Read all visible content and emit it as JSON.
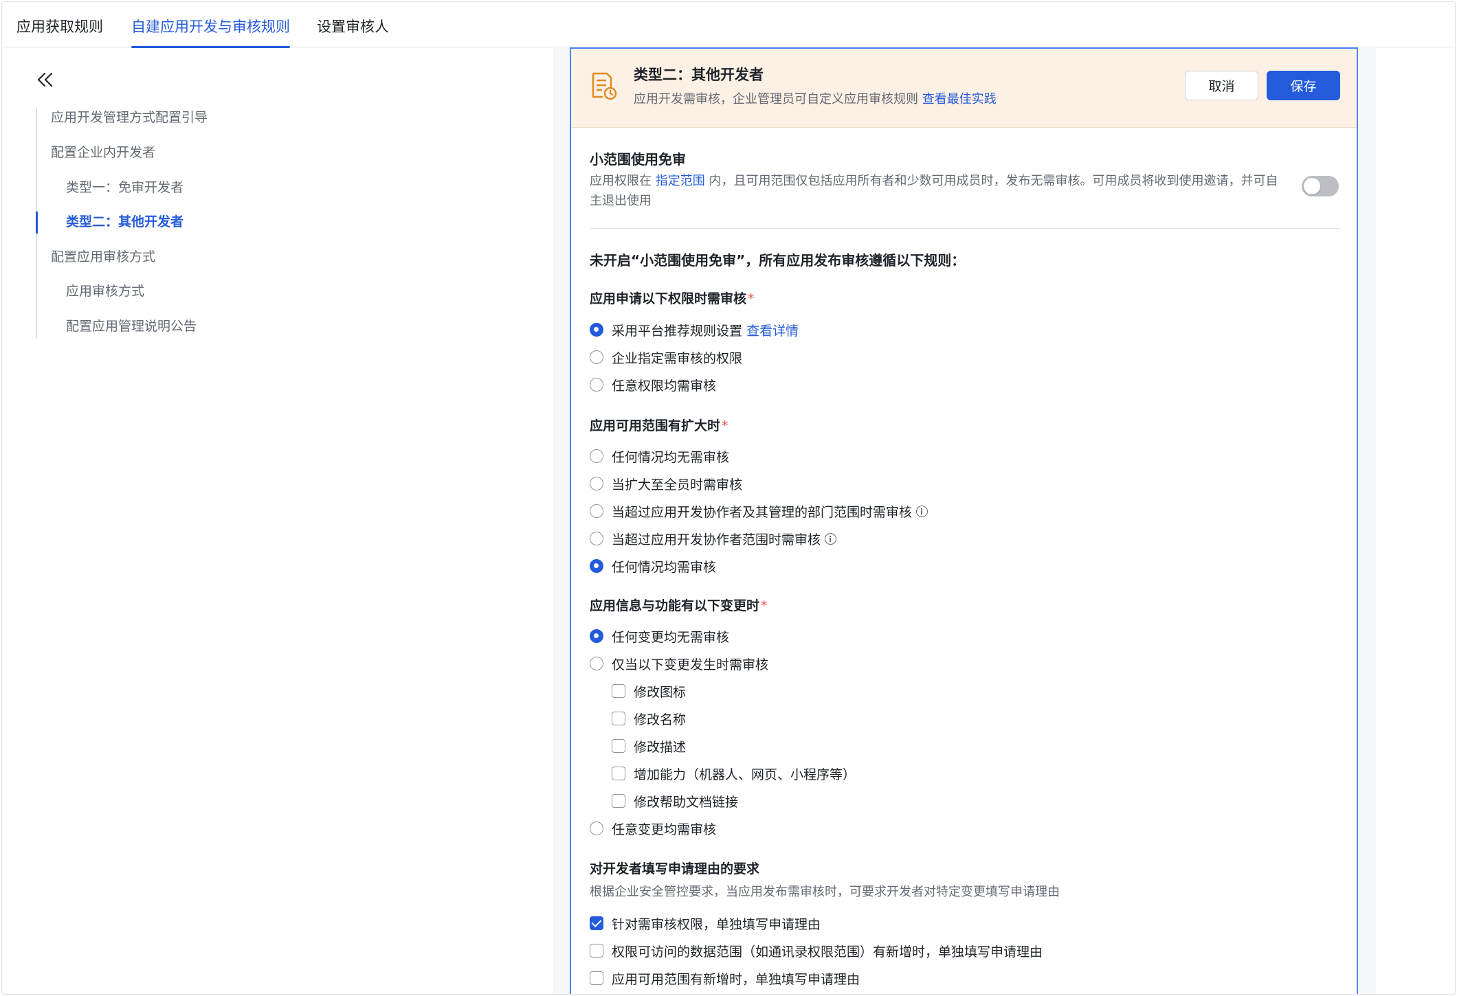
{
  "tabs": [
    {
      "label": "应用获取规则"
    },
    {
      "label": "自建应用开发与审核规则",
      "active": true
    },
    {
      "label": "设置审核人"
    }
  ],
  "sidebar": {
    "collapse_icon": "double-chevron-left-icon",
    "items": [
      {
        "label": "应用开发管理方式配置引导"
      },
      {
        "label": "配置企业内开发者"
      },
      {
        "label": "类型一：免审开发者"
      },
      {
        "label": "类型二：其他开发者",
        "active": true
      },
      {
        "label": "配置应用审核方式"
      },
      {
        "label": "应用审核方式"
      },
      {
        "label": "配置应用管理说明公告"
      }
    ]
  },
  "banner": {
    "icon": "document-clock-icon",
    "title": "类型二：其他开发者",
    "desc": "应用开发需审核，企业管理员可自定义应用审核规则",
    "link": "查看最佳实践",
    "cancel_label": "取消",
    "save_label": "保存"
  },
  "exempt": {
    "title": "小范围使用免审",
    "desc_prefix": "应用权限在",
    "desc_link": "指定范围",
    "desc_suffix": "内，且可用范围仅包括应用所有者和少数可用成员时，发布无需审核。可用成员将收到使用邀请，并可自主退出使用",
    "enabled": false
  },
  "rules_title": "未开启“小范围使用免审”，所有应用发布审核遵循以下规则：",
  "permission_review": {
    "title": "应用申请以下权限时需审核",
    "required_mark": "*",
    "options": [
      {
        "label": "采用平台推荐规则设置",
        "link": "查看详情",
        "selected": true
      },
      {
        "label": "企业指定需审核的权限",
        "selected": false
      },
      {
        "label": "任意权限均需审核",
        "selected": false
      }
    ]
  },
  "scope_review": {
    "title": "应用可用范围有扩大时",
    "required_mark": "*",
    "options": [
      {
        "label": "任何情况均无需审核",
        "selected": false
      },
      {
        "label": "当扩大至全员时需审核",
        "selected": false
      },
      {
        "label": "当超过应用开发协作者及其管理的部门范围时需审核",
        "selected": false,
        "info": true
      },
      {
        "label": "当超过应用开发协作者范围时需审核",
        "selected": false,
        "info": true
      },
      {
        "label": "任何情况均需审核",
        "selected": true
      }
    ]
  },
  "change_review": {
    "title": "应用信息与功能有以下变更时",
    "required_mark": "*",
    "options": [
      {
        "label": "任何变更均无需审核",
        "selected": true
      },
      {
        "label": "仅当以下变更发生时需审核",
        "selected": false
      },
      {
        "label": "任意变更均需审核",
        "selected": false
      }
    ],
    "sub_checks": [
      {
        "label": "修改图标",
        "checked": false
      },
      {
        "label": "修改名称",
        "checked": false
      },
      {
        "label": "修改描述",
        "checked": false
      },
      {
        "label": "增加能力（机器人、网页、小程序等）",
        "checked": false
      },
      {
        "label": "修改帮助文档链接",
        "checked": false
      }
    ]
  },
  "reason_req": {
    "title": "对开发者填写申请理由的要求",
    "desc": "根据企业安全管控要求，当应用发布需审核时，可要求开发者对特定变更填写申请理由",
    "checks": [
      {
        "label": "针对需审核权限，单独填写申请理由",
        "checked": true
      },
      {
        "label": "权限可访问的数据范围（如通讯录权限范围）有新增时，单独填写申请理由",
        "checked": false
      },
      {
        "label": "应用可用范围有新增时，单独填写申请理由",
        "checked": false
      }
    ]
  },
  "colors": {
    "accent": "#245bdb",
    "banner_bg": "#fdf0e4",
    "banner_icon": "#e08a1e",
    "required": "#f54a45"
  }
}
